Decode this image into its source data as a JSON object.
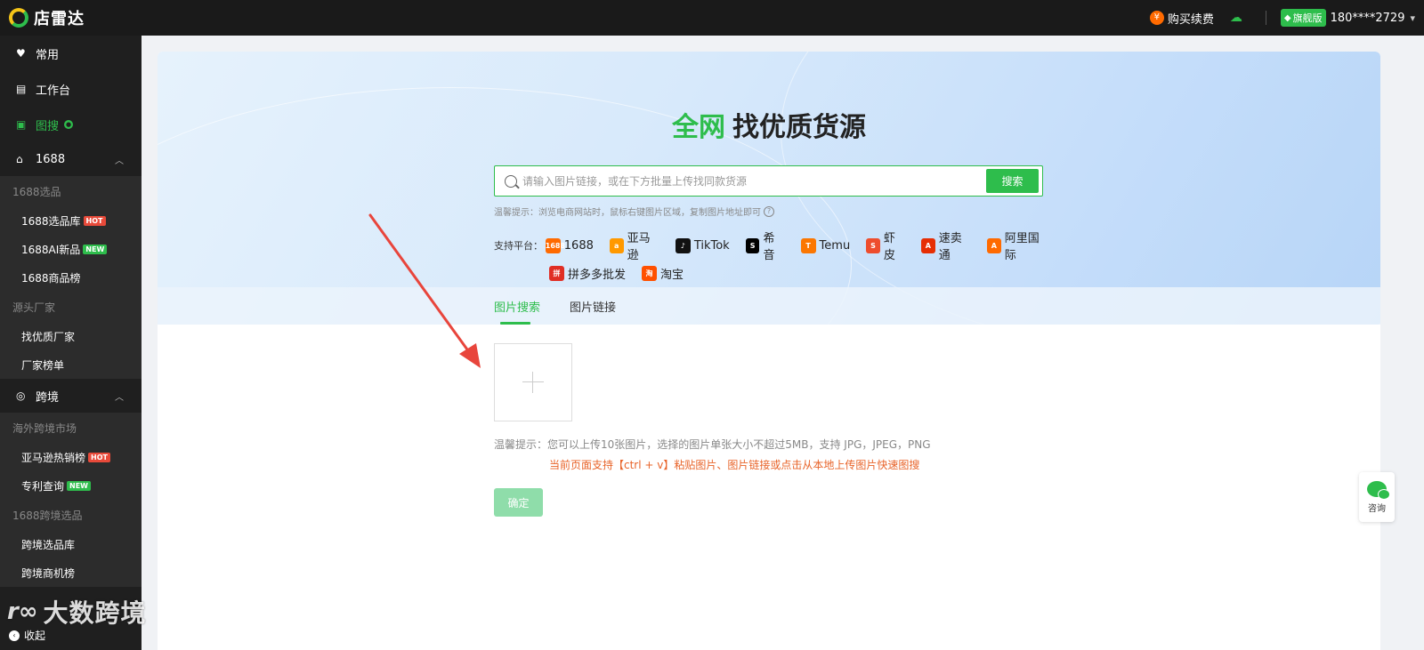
{
  "header": {
    "logo_text": "店雷达",
    "buy_label": "购买续费",
    "buy_icon": "¥",
    "vip_label": "旗舰版",
    "user_phone": "180****2729"
  },
  "sidebar": {
    "top_items": [
      {
        "label": "常用",
        "icon": "heart-icon"
      },
      {
        "label": "工作台",
        "icon": "workbench-icon"
      },
      {
        "label": "图搜",
        "icon": "image-search-icon",
        "active": true
      }
    ],
    "group_1688": {
      "label": "1688",
      "sections": [
        {
          "head": "1688选品",
          "items": [
            {
              "label": "1688选品库",
              "tag": "HOT"
            },
            {
              "label": "1688AI新品",
              "tag": "NEW"
            },
            {
              "label": "1688商品榜",
              "tag": ""
            }
          ]
        },
        {
          "head": "源头厂家",
          "items": [
            {
              "label": "找优质厂家",
              "tag": ""
            },
            {
              "label": "厂家榜单",
              "tag": ""
            }
          ]
        }
      ]
    },
    "group_cross": {
      "label": "跨境",
      "sections": [
        {
          "head": "海外跨境市场",
          "items": [
            {
              "label": "亚马逊热销榜",
              "tag": "HOT"
            },
            {
              "label": "专利查询",
              "tag": "NEW"
            }
          ]
        },
        {
          "head": "1688跨境选品",
          "items": [
            {
              "label": "跨境选品库",
              "tag": ""
            },
            {
              "label": "跨境商机榜",
              "tag": ""
            }
          ]
        }
      ]
    },
    "collapse_label": "收起"
  },
  "hero": {
    "title_accent": "全网",
    "title_rest": "找优质货源",
    "search_placeholder": "请输入图片链接，或在下方批量上传找同款货源",
    "search_button": "搜索",
    "hint": "温馨提示：浏览电商网站时，鼠标右键图片区域，复制图片地址即可",
    "platforms_label": "支持平台：",
    "platforms_row1": [
      {
        "name": "1688",
        "icon_text": "1688",
        "color": "#ff6a00"
      },
      {
        "name": "亚马逊",
        "icon_text": "a",
        "color": "#ff9900"
      },
      {
        "name": "TikTok",
        "icon_text": "♪",
        "color": "#111111"
      },
      {
        "name": "希音",
        "icon_text": "S",
        "color": "#000000"
      },
      {
        "name": "Temu",
        "icon_text": "T",
        "color": "#fb7701"
      },
      {
        "name": "虾皮",
        "icon_text": "S",
        "color": "#ee4d2d"
      },
      {
        "name": "速卖通",
        "icon_text": "A",
        "color": "#e62e04"
      },
      {
        "name": "阿里国际",
        "icon_text": "A",
        "color": "#ff6a00"
      }
    ],
    "platforms_row2": [
      {
        "name": "拼多多批发",
        "icon_text": "拼",
        "color": "#e02e24"
      },
      {
        "name": "淘宝",
        "icon_text": "淘",
        "color": "#ff5000"
      }
    ]
  },
  "tabs": [
    {
      "label": "图片搜索",
      "active": true
    },
    {
      "label": "图片链接",
      "active": false
    }
  ],
  "upload": {
    "hint": "温馨提示：您可以上传10张图片，选择的图片单张大小不超过5MB，支持 JPG，JPEG，PNG",
    "paste_hint": "当前页面支持【ctrl + v】粘贴图片、图片链接或点击从本地上传图片快速图搜",
    "confirm_label": "确定"
  },
  "consult_label": "咨询",
  "watermark": {
    "logo": "r∞",
    "text": "大数跨境"
  },
  "colors": {
    "accent": "#2ebd4c",
    "warning": "#e8642a",
    "arrow": "#e8453c"
  }
}
